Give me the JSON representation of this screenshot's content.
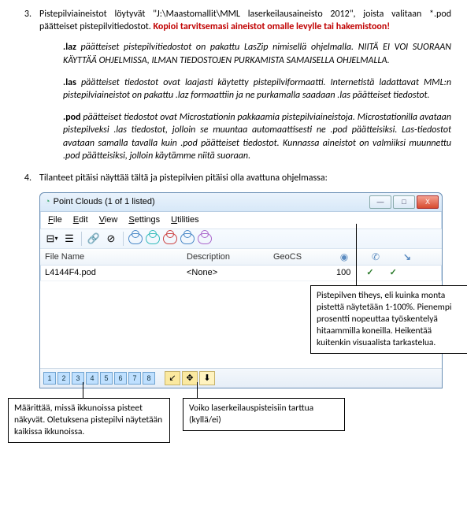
{
  "item3": {
    "num": "3.",
    "text_a": "Pistepilviaineistot löytyvät \"J:\\Maastomallit\\MML laserkeilausaineisto 2012\", joista valitaan *.pod päätteiset pistepilvitiedostot. ",
    "text_red": "Kopioi tarvitsemasi aineistot omalle levylle tai hakemistoon!"
  },
  "sub_laz": {
    "lead": ".laz",
    "rest": " päätteiset pistepilvitiedostot on pakattu LasZip nimisellä ohjelmalla. NIITÄ EI VOI SUORAAN KÄYTTÄÄ OHJELMISSA, ILMAN TIEDOSTOJEN PURKAMISTA SAMAISELLA OHJELMALLA."
  },
  "sub_las": {
    "lead": ".las",
    "rest": " päätteiset tiedostot ovat laajasti käytetty pistepilviformaatti. Internetistä ladattavat MML:n pistepilviaineistot on pakattu .laz formaattiin ja ne purkamalla saadaan .las päätteiset tiedostot."
  },
  "sub_pod": {
    "lead": ".pod",
    "rest": " päätteiset tiedostot ovat Microstationin pakkaamia pistepilviaineistoja. Microstationilla avataan pistepilveksi .las tiedostot, jolloin se muuntaa automaattisesti ne .pod päätteisiksi. Las-tiedostot avataan samalla tavalla kuin .pod päätteiset tiedostot. Kunnassa aineistot on valmiiksi muunnettu .pod päätteisiksi, jolloin käytämme niitä suoraan."
  },
  "item4": {
    "num": "4.",
    "text": "Tilanteet pitäisi näyttää tältä ja pistepilvien pitäisi olla avattuna ohjelmassa:"
  },
  "window": {
    "title": "Point Clouds (1 of 1 listed)",
    "menu": {
      "file": "File",
      "edit": "Edit",
      "view": "View",
      "settings": "Settings",
      "utilities": "Utilities"
    },
    "columns": {
      "file": "File Name",
      "desc": "Description",
      "geo": "GeoCS"
    },
    "row": {
      "file": "L4144F4.pod",
      "desc": "<None>",
      "density": "100",
      "on1": "✓",
      "on2": "✓"
    },
    "numbuttons": [
      "1",
      "2",
      "3",
      "4",
      "5",
      "6",
      "7",
      "8"
    ],
    "btn_min": "—",
    "btn_max": "□",
    "btn_close": "X"
  },
  "callouts": {
    "density": "Pistepilven tiheys, eli kuinka monta pistettä näytetään 1-100%. Pienempi prosentti nopeuttaa työskentelyä hitaammilla koneilla. Heikentää kuitenkin visuaalista tarkastelua.",
    "views": "Määrittää, missä ikkunoissa pisteet näkyvät. Oletuksena pistepilvi näytetään kaikissa ikkunoissa.",
    "snap": "Voiko laserkeilauspisteisiin tarttua (kyllä/ei)"
  }
}
